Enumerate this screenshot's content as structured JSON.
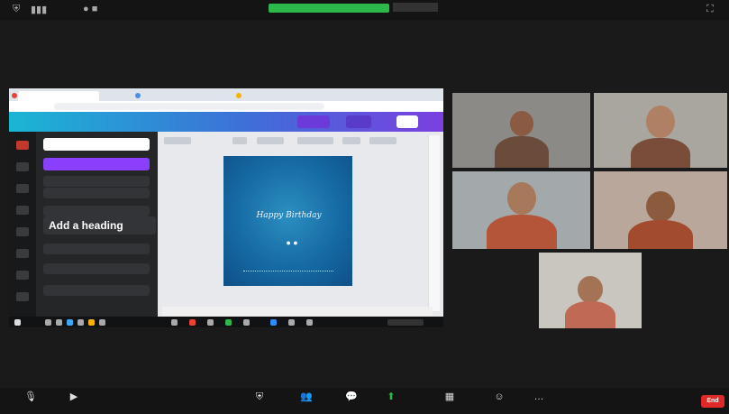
{
  "meeting": {
    "speaker_name": "",
    "participant_count": ""
  },
  "canva": {
    "panel_heading_button": "Add a heading",
    "search_placeholder": "",
    "design_title": "Happy Birthday",
    "design_dots": "● ●"
  },
  "toolbar": {
    "controls": [
      {
        "icon": "mic-icon",
        "glyph": "🎙",
        "label": ""
      },
      {
        "icon": "video-icon",
        "glyph": "▶",
        "label": ""
      },
      {
        "icon": "security-icon",
        "glyph": "⛨",
        "label": ""
      },
      {
        "icon": "participants-icon",
        "glyph": "👥",
        "label": ""
      },
      {
        "icon": "chat-icon",
        "glyph": "💬",
        "label": ""
      },
      {
        "icon": "share-screen-icon",
        "glyph": "⬆",
        "label": ""
      },
      {
        "icon": "breakout-rooms-icon",
        "glyph": "▦",
        "label": ""
      },
      {
        "icon": "reactions-icon",
        "glyph": "☺",
        "label": ""
      },
      {
        "icon": "more-icon",
        "glyph": "…",
        "label": ""
      }
    ],
    "end_label": "End"
  },
  "colors": {
    "accent_green": "#2db84b",
    "canva_purple": "#8a3ffc",
    "end_red": "#e02828"
  }
}
